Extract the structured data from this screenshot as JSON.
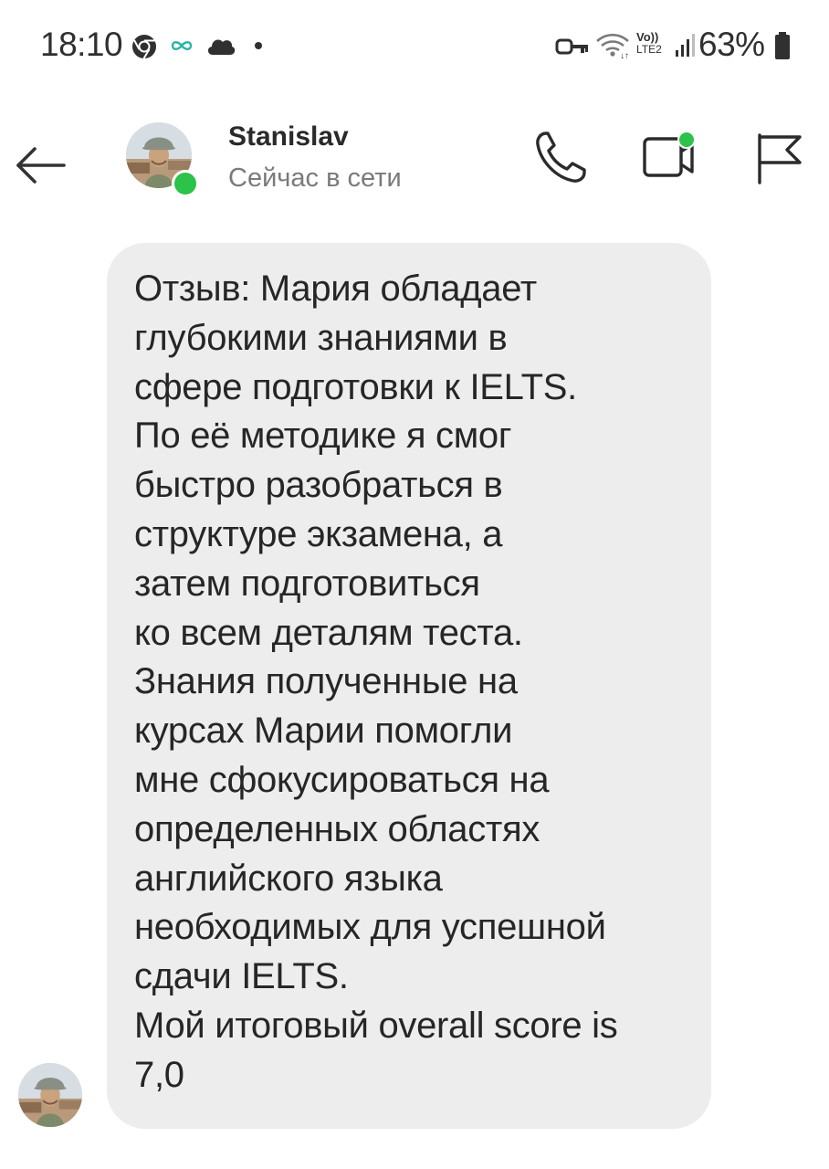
{
  "status_bar": {
    "time": "18:10",
    "left_icons": [
      "chrome-icon",
      "link-icon",
      "cloud-icon",
      "dot-icon"
    ],
    "right_icons": [
      "vpn-key-icon",
      "wifi-icon",
      "volte-lte-icon",
      "signal-icon",
      "battery-icon"
    ],
    "network_label_top": "Vo))",
    "network_label_bottom": "LTE2",
    "battery": "63%"
  },
  "header": {
    "back_icon": "arrow-left-icon",
    "contact_name": "Stanislav",
    "contact_status": "Сейчас в сети",
    "online": true,
    "online_color": "#2dc24a",
    "actions": [
      "phone-icon",
      "video-call-icon",
      "flag-icon"
    ]
  },
  "message": {
    "text": "Отзыв: Мария обладает\nглубокими знаниями в\nсфере подготовки к IELTS.\nПо её методике я смог\nбыстро разобраться в\nструктуре экзамена, а\nзатем подготовиться\nко всем деталям теста.\nЗнания полученные на\nкурсах Марии помогли\nмне сфокусироваться на\nопределенных областях\nанглийского языка\nнеобходимых для успешной\nсдачи IELTS.\nМой итоговый overall score is\n7,0",
    "bubble_color": "#ededed"
  }
}
